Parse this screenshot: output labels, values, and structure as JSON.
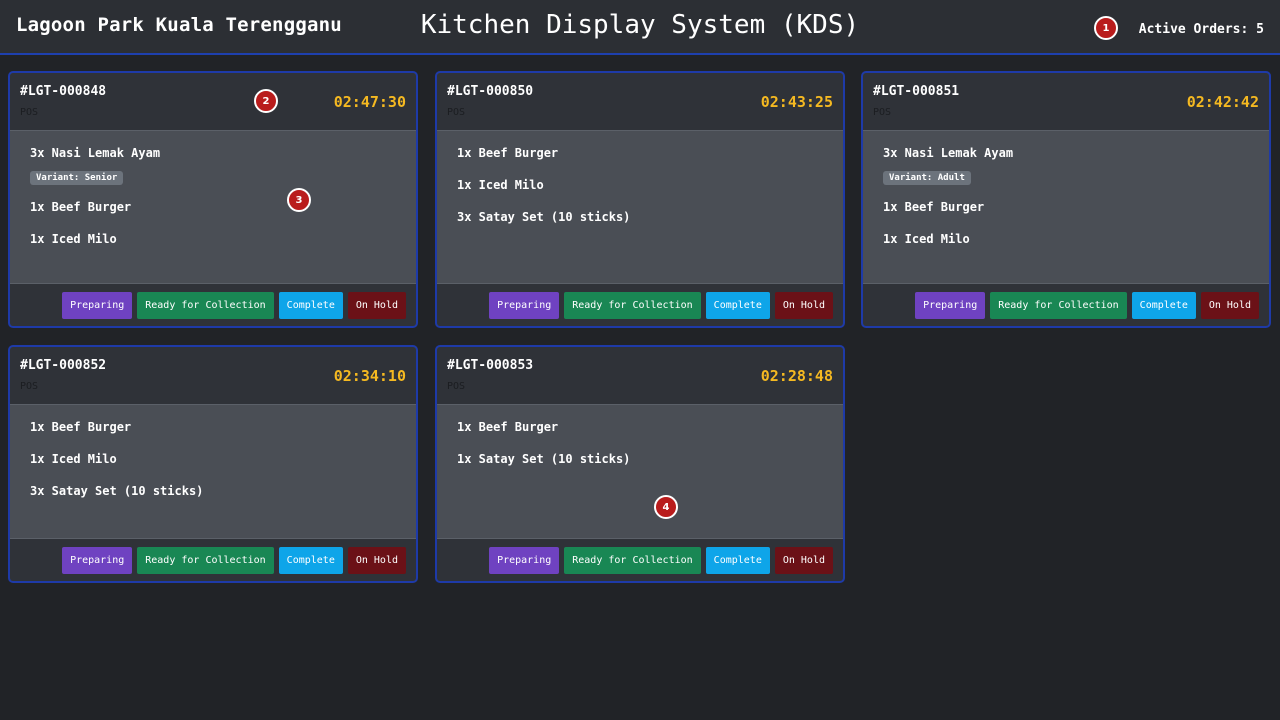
{
  "header": {
    "venue": "Lagoon Park Kuala Terengganu",
    "title": "Kitchen Display System (KDS)",
    "active_orders": "Active Orders: 5"
  },
  "markers": [
    "1",
    "2",
    "3",
    "4"
  ],
  "actions": {
    "preparing": "Preparing",
    "ready": "Ready for Collection",
    "complete": "Complete",
    "hold": "On Hold"
  },
  "orders": [
    {
      "id": "#LGT-000848",
      "source": "POS",
      "timer": "02:47:30",
      "items": [
        {
          "label": "3x Nasi Lemak Ayam",
          "variant": "Variant: Senior"
        },
        {
          "label": "1x Beef Burger"
        },
        {
          "label": "1x Iced Milo"
        }
      ]
    },
    {
      "id": "#LGT-000850",
      "source": "POS",
      "timer": "02:43:25",
      "items": [
        {
          "label": "1x Beef Burger"
        },
        {
          "label": "1x Iced Milo"
        },
        {
          "label": "3x Satay Set (10 sticks)"
        }
      ]
    },
    {
      "id": "#LGT-000851",
      "source": "POS",
      "timer": "02:42:42",
      "items": [
        {
          "label": "3x Nasi Lemak Ayam",
          "variant": "Variant: Adult"
        },
        {
          "label": "1x Beef Burger"
        },
        {
          "label": "1x Iced Milo"
        }
      ]
    },
    {
      "id": "#LGT-000852",
      "source": "POS",
      "timer": "02:34:10",
      "items": [
        {
          "label": "1x Beef Burger"
        },
        {
          "label": "1x Iced Milo"
        },
        {
          "label": "3x Satay Set (10 sticks)"
        }
      ]
    },
    {
      "id": "#LGT-000853",
      "source": "POS",
      "timer": "02:28:48",
      "items": [
        {
          "label": "1x Beef Burger"
        },
        {
          "label": "1x Satay Set (10 sticks)"
        }
      ]
    }
  ],
  "colors": {
    "accent": "#1e40af",
    "timer": "#f5b921",
    "preparing": "#6f42c1",
    "ready": "#198754",
    "complete": "#0ea5e9",
    "hold": "#6b1117"
  }
}
